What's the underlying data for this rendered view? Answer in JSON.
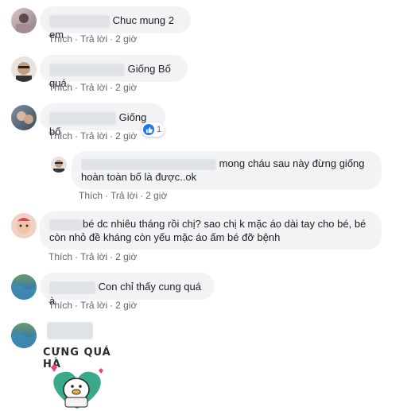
{
  "actions": {
    "like": "Thích",
    "reply": "Trả lời",
    "separator": "·"
  },
  "comments": [
    {
      "text": "Chuc mung 2 em",
      "time": "2 giờ"
    },
    {
      "text": "Giống Bố quá.",
      "time": "2 giờ"
    },
    {
      "text": "Giống bố",
      "time": "2 giờ",
      "reaction_count": "1"
    },
    {
      "text_line1": "mong cháu sau này đừng giống",
      "text_line2": "hoàn toàn bố là được..ok",
      "time": "2 giờ"
    },
    {
      "text_line1": "bé dc nhiêu tháng rồi chị? sao chị k mặc áo dài tay cho bé, bé",
      "text_line2": "còn nhỏ đề kháng còn yếu mặc áo ấm bé đỡ bệnh",
      "time": "2 giờ"
    },
    {
      "text": "Con chỉ thấy cung quá à",
      "time": "2 giờ"
    },
    {
      "sticker_caption": "CƯNG QUÁ HÀ"
    }
  ],
  "colors": {
    "bubble": "#f2f3f5",
    "meta": "#606770",
    "like_blue": "#1877f2",
    "sticker_heart": "#e8457a",
    "sticker_green": "#3aa88a"
  }
}
